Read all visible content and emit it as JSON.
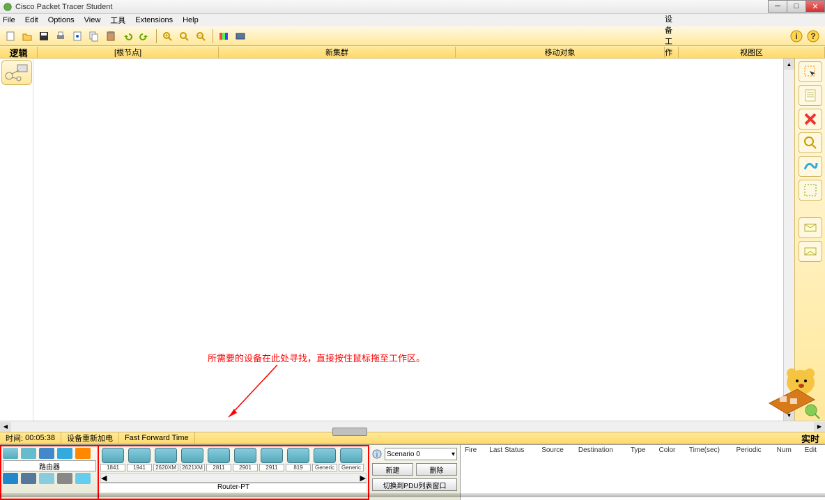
{
  "window": {
    "title": "Cisco Packet Tracer Student"
  },
  "menu": {
    "file": "File",
    "edit": "Edit",
    "options": "Options",
    "view": "View",
    "tools": "工具",
    "extensions": "Extensions",
    "help": "Help"
  },
  "navbar": {
    "logic": "逻辑",
    "root": "[根节点]",
    "newcluster": "新集群",
    "moveobj": "移动对象",
    "bg": "设备工作区背景",
    "view": "视图区"
  },
  "annotation": {
    "text": "所需要的设备在此处寻找，直接按住鼠标拖至工作区。"
  },
  "timebar": {
    "time_label": "时间:",
    "time_value": "00:05:38",
    "power": "设备重新加电",
    "fft": "Fast Forward Time",
    "realtime": "实时"
  },
  "categories": {
    "label": "路由器",
    "selected_device": "Router-PT"
  },
  "devices": [
    {
      "label": "1841"
    },
    {
      "label": "1941"
    },
    {
      "label": "2620XM"
    },
    {
      "label": "2621XM"
    },
    {
      "label": "2811"
    },
    {
      "label": "2901"
    },
    {
      "label": "2911"
    },
    {
      "label": "819"
    },
    {
      "label": "Generic"
    },
    {
      "label": "Generic"
    }
  ],
  "scenario": {
    "selected": "Scenario 0",
    "new": "新建",
    "delete": "删除",
    "pdu_list": "切换到PDU列表窗口"
  },
  "pdu_headers": {
    "fire": "Fire",
    "last_status": "Last Status",
    "source": "Source",
    "destination": "Destination",
    "type": "Type",
    "color": "Color",
    "time": "Time(sec)",
    "periodic": "Periodic",
    "num": "Num",
    "edit": "Edit"
  }
}
